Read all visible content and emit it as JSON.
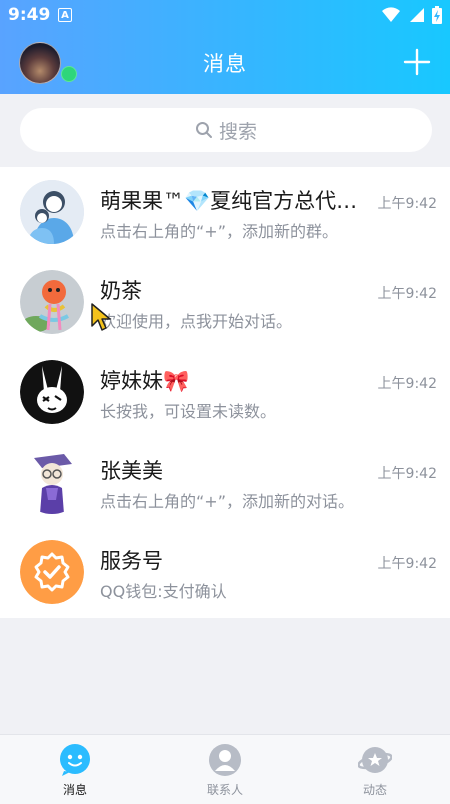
{
  "statusbar": {
    "time": "9:49",
    "badge": "A"
  },
  "header": {
    "title": "消息"
  },
  "search": {
    "placeholder": "搜索"
  },
  "conversations": [
    {
      "name": "萌果果™💎夏纯官方总代创...",
      "preview": "点击右上角的“+”，添加新的群。",
      "time": "上午9:42",
      "avatar": "group-avatar-icon"
    },
    {
      "name": "奶茶",
      "preview": "欢迎使用，点我开始对话。",
      "time": "上午9:42",
      "avatar": "toy-avatar"
    },
    {
      "name": "婷妹妹🎀",
      "preview": "长按我，可设置未读数。",
      "time": "上午9:42",
      "avatar": "rabbit-avatar"
    },
    {
      "name": "张美美",
      "preview": "点击右上角的“+”，添加新的对话。",
      "time": "上午9:42",
      "avatar": "cartoon-avatar"
    },
    {
      "name": "服务号",
      "preview": "QQ钱包:支付确认",
      "time": "上午9:42",
      "avatar": "service-badge-icon"
    }
  ],
  "tabs": [
    {
      "label": "消息",
      "icon": "chat-bubble-icon",
      "active": true
    },
    {
      "label": "联系人",
      "icon": "contact-icon",
      "active": false
    },
    {
      "label": "动态",
      "icon": "planet-icon",
      "active": false
    }
  ],
  "colors": {
    "header_start": "#59a3ff",
    "header_end": "#18c8ff",
    "online": "#2ed67a",
    "service_orange": "#ff9d45"
  }
}
